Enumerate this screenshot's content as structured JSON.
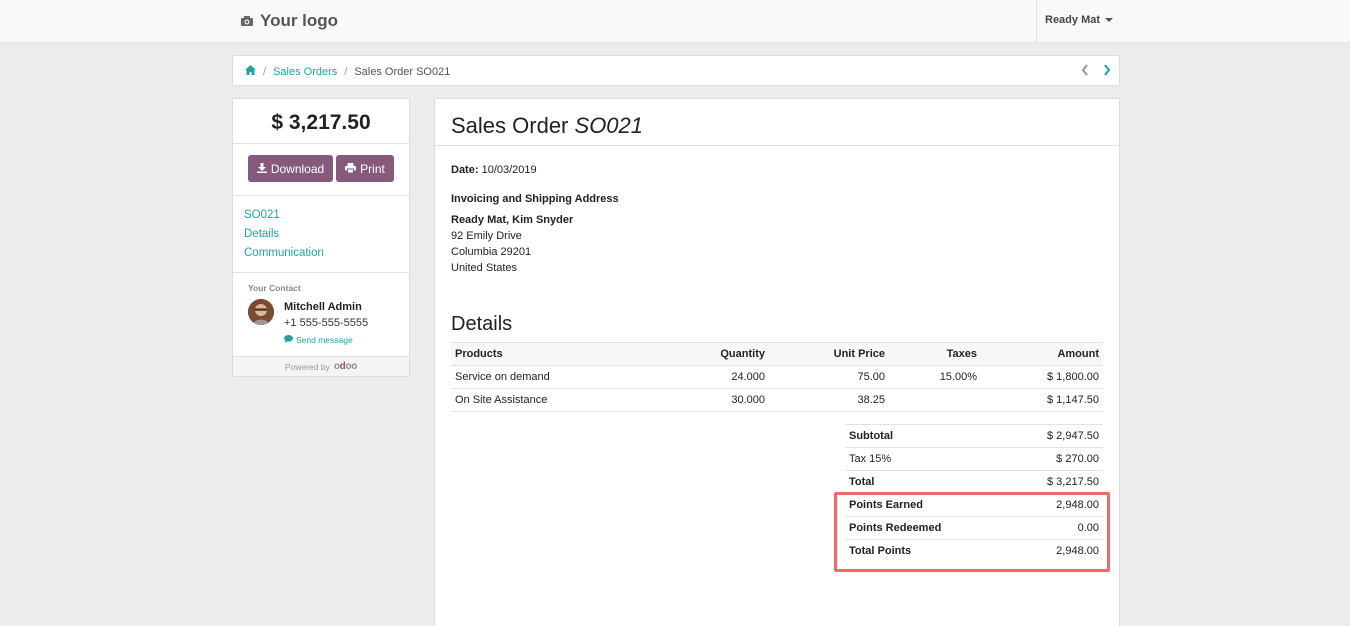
{
  "header": {
    "logo_text": "Your logo",
    "user_name": "Ready Mat"
  },
  "breadcrumb": {
    "items": [
      "Sales Orders",
      "Sales Order SO021"
    ]
  },
  "sidebar": {
    "total": "$ 3,217.50",
    "download_label": "Download",
    "print_label": "Print",
    "links": [
      "SO021",
      "Details",
      "Communication"
    ],
    "contact_title": "Your Contact",
    "contact_name": "Mitchell Admin",
    "contact_phone": "+1 555-555-5555",
    "send_message": "Send message",
    "powered_by": "Powered by",
    "brand": "odoo"
  },
  "order": {
    "title": "Sales Order",
    "number": "SO021",
    "date_label": "Date:",
    "date": "10/03/2019",
    "address_title": "Invoicing and Shipping Address",
    "address_name": "Ready Mat, Kim Snyder",
    "address_lines": [
      "92 Emily Drive",
      "Columbia 29201",
      "United States"
    ],
    "details_title": "Details"
  },
  "table": {
    "columns": [
      "Products",
      "Quantity",
      "Unit Price",
      "Taxes",
      "Amount"
    ],
    "rows": [
      [
        "Service on demand",
        "24.000",
        "75.00",
        "15.00%",
        "$ 1,800.00"
      ],
      [
        "On Site Assistance",
        "30.000",
        "38.25",
        "",
        "$ 1,147.50"
      ]
    ]
  },
  "totals": [
    {
      "label": "Subtotal",
      "value": "$ 2,947.50",
      "bold": true
    },
    {
      "label": "Tax 15%",
      "value": "$ 270.00",
      "bold": false
    },
    {
      "label": "Total",
      "value": "$ 3,217.50",
      "bold": true
    },
    {
      "label": "Points Earned",
      "value": "2,948.00",
      "bold": true
    },
    {
      "label": "Points Redeemed",
      "value": "0.00",
      "bold": true
    },
    {
      "label": "Total Points",
      "value": "2,948.00",
      "bold": true
    }
  ],
  "colors": {
    "accent": "#21a3a1",
    "button": "#875a7b",
    "highlight": "#f2696a"
  }
}
